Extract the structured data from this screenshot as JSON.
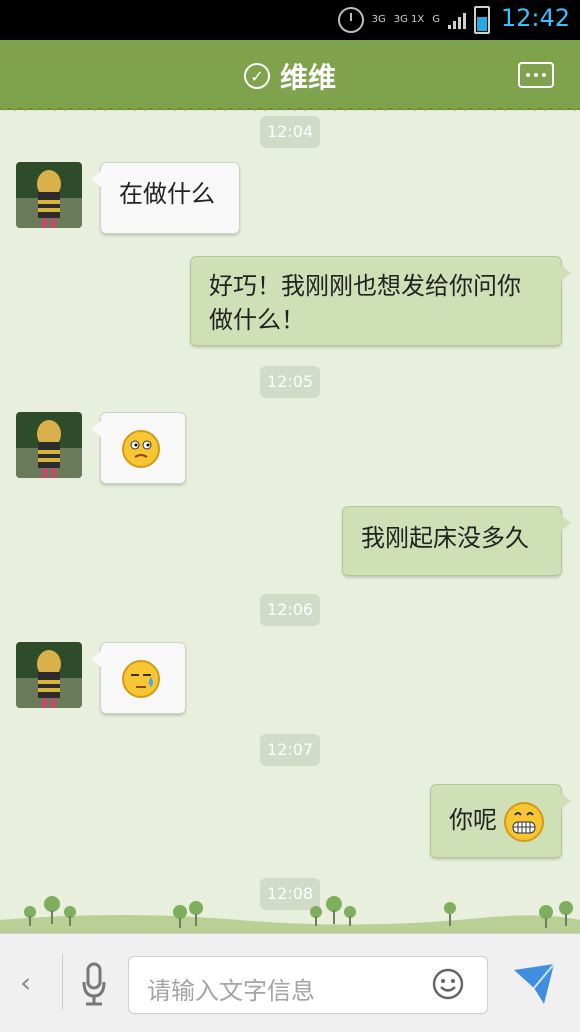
{
  "status_bar": {
    "network": [
      "3G",
      "3G 1X",
      "G"
    ],
    "time": "12:42"
  },
  "header": {
    "title": "维维",
    "online_icon": "check-circle-icon",
    "more_icon": "more-icon"
  },
  "messages": [
    {
      "type": "timestamp",
      "text": "12:04"
    },
    {
      "type": "incoming",
      "text": "在做什么"
    },
    {
      "type": "outgoing",
      "text": "好巧！我刚刚也想发给你问你做什么！"
    },
    {
      "type": "timestamp",
      "text": "12:05"
    },
    {
      "type": "incoming",
      "emoji": "puzzled-face-icon"
    },
    {
      "type": "outgoing",
      "text": "我刚起床没多久"
    },
    {
      "type": "timestamp",
      "text": "12:06"
    },
    {
      "type": "incoming",
      "emoji": "sweat-face-icon"
    },
    {
      "type": "timestamp",
      "text": "12:07"
    },
    {
      "type": "outgoing",
      "text": "你呢",
      "emoji": "grin-face-icon"
    },
    {
      "type": "timestamp",
      "text": "12:08"
    }
  ],
  "input": {
    "placeholder": "请输入文字信息"
  },
  "colors": {
    "header": "#7fa24c",
    "chat_bg": "#e8efdc",
    "outgoing": "#cfe0b6",
    "incoming": "#f8f8f8",
    "send": "#3f8ee0"
  }
}
